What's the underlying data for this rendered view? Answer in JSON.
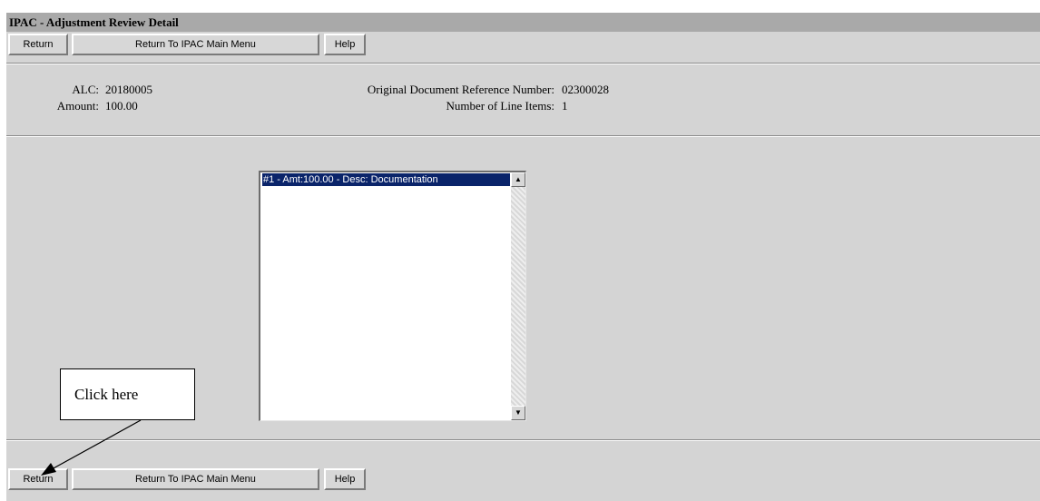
{
  "title": "IPAC - Adjustment Review Detail",
  "toolbar": {
    "return_label": "Return",
    "main_menu_label": "Return To IPAC Main Menu",
    "help_label": "Help"
  },
  "details": {
    "alc_label": "ALC:",
    "alc_value": "20180005",
    "amount_label": "Amount:",
    "amount_value": "100.00",
    "orig_doc_ref_label": "Original Document Reference Number:",
    "orig_doc_ref_value": "02300028",
    "line_items_label": "Number of Line Items:",
    "line_items_value": "1"
  },
  "line_items": {
    "selected": "#1 - Amt:100.00 - Desc: Documentation"
  },
  "callout": {
    "text": "Click here"
  },
  "colors": {
    "title_bar": "#a9a9a9",
    "panel": "#d4d4d4",
    "selection": "#0a246a"
  }
}
